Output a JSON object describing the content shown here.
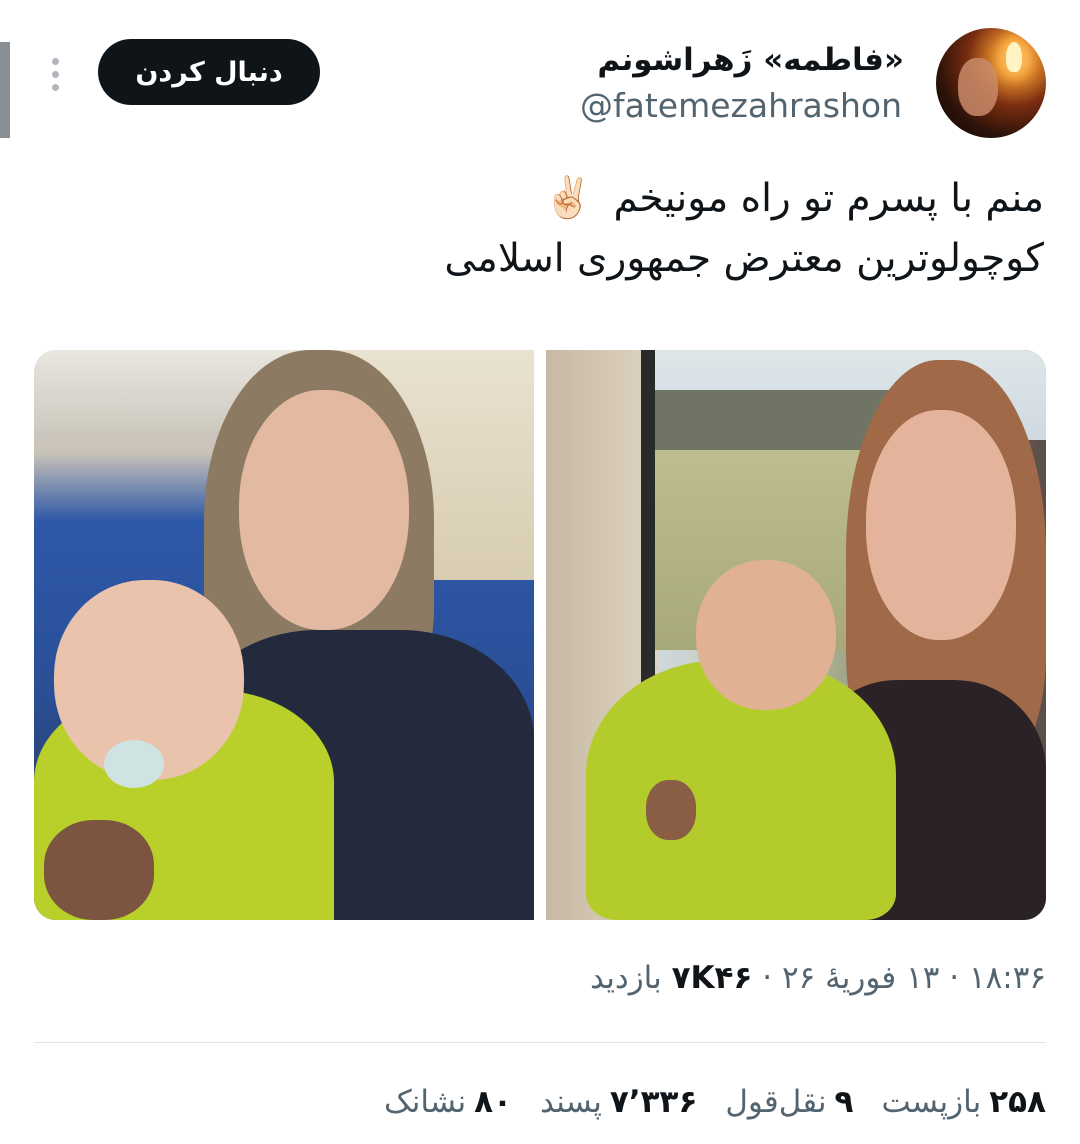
{
  "header": {
    "display_name": "«فاطمه» زَهراشونم",
    "handle": "@fatemezahrashon",
    "follow_label": "دنبال کردن",
    "avatar_icon": "avatar-photo",
    "more_icon": "more-vertical-icon"
  },
  "tweet": {
    "line1": "منم با پسرم تو راه مونیخم",
    "emoji": "✌🏻",
    "line2": "کوچولوترین معترض جمهوری اسلامی"
  },
  "meta": {
    "time": "۱۸:۳۶",
    "sep1": "·",
    "date": "۱۳ فوریهٔ ۲۶",
    "sep2": "·",
    "views_count": "۷K۴۶",
    "views_label": "بازدید"
  },
  "stats": {
    "reposts_count": "۲۵۸",
    "reposts_label": "بازپست",
    "quotes_count": "۹",
    "quotes_label": "نقل‌قول",
    "likes_count": "۷٬۳۳۶",
    "likes_label": "پسند",
    "bookmarks_count": "۸۰",
    "bookmarks_label": "نشانک"
  },
  "colors": {
    "primary_text": "#0f1419",
    "secondary_text": "#536471",
    "button_bg": "#0f1419",
    "button_text": "#ffffff",
    "divider": "#dfe3e6"
  }
}
